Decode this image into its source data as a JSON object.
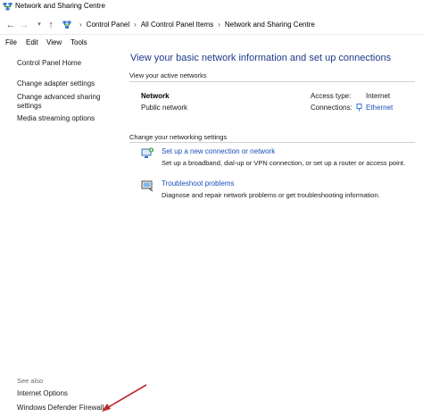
{
  "window": {
    "title": "Network and Sharing Centre"
  },
  "address": {
    "breadcrumbs": [
      "Control Panel",
      "All Control Panel Items",
      "Network and Sharing Centre"
    ],
    "back_glyph": "←",
    "forward_glyph": "→",
    "dropdown_glyph": "▾",
    "up_glyph": "↑"
  },
  "menu": {
    "items": [
      "File",
      "Edit",
      "View",
      "Tools"
    ]
  },
  "sidebar": {
    "items": [
      {
        "label": "Control Panel Home"
      },
      {
        "label": "Change adapter settings"
      },
      {
        "label": "Change advanced sharing settings"
      },
      {
        "label": "Media streaming options"
      }
    ],
    "see_also_label": "See also",
    "see_also": [
      {
        "label": "Internet Options"
      },
      {
        "label": "Windows Defender Firewall"
      }
    ]
  },
  "main": {
    "title": "View your basic network information and set up connections",
    "active_networks_label": "View your active networks",
    "network": {
      "name": "Network",
      "type": "Public network",
      "access_type_label": "Access type:",
      "access_type_value": "Internet",
      "connections_label": "Connections:",
      "connection_value": "Ethernet"
    },
    "change_settings_label": "Change your networking settings",
    "tasks": [
      {
        "link": "Set up a new connection or network",
        "desc": "Set up a broadband, dial-up or VPN connection, or set up a router or access point.",
        "icon": "new-connection-icon"
      },
      {
        "link": "Troubleshoot problems",
        "desc": "Diagnose and repair network problems or get troubleshooting information.",
        "icon": "troubleshoot-icon"
      }
    ]
  },
  "colors": {
    "link": "#1a4fb8",
    "title": "#1e3a8a",
    "annotation_arrow": "#c0262d"
  }
}
